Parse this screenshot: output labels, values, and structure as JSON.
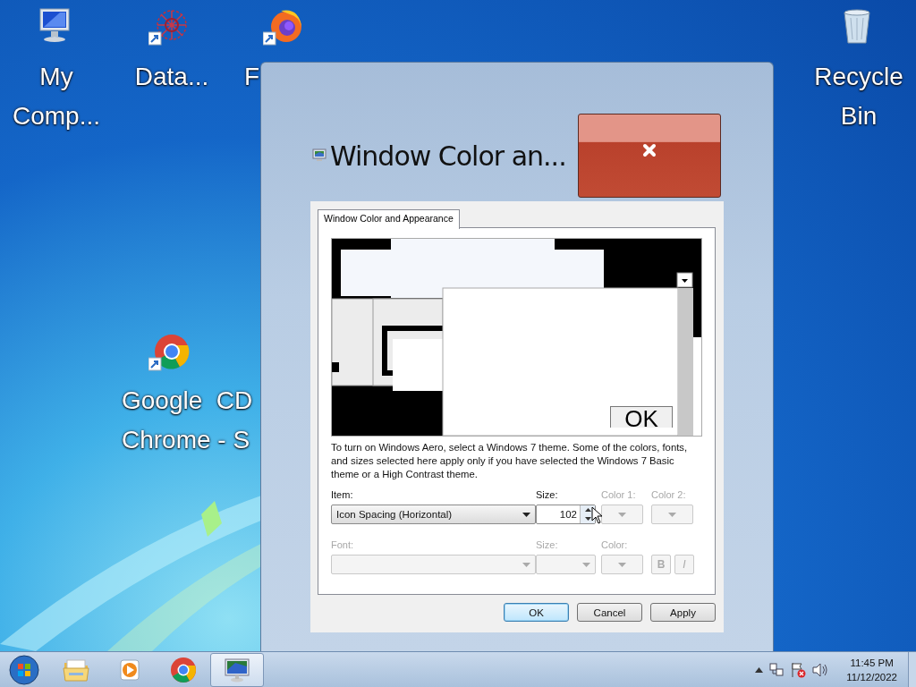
{
  "desktop_icons": [
    {
      "kind": "computer",
      "shortcut": false,
      "lines": [
        "My",
        "Comp..."
      ]
    },
    {
      "kind": "web",
      "shortcut": true,
      "lines": [
        "Data..."
      ]
    },
    {
      "kind": "firefox",
      "shortcut": true,
      "lines": [
        "F"
      ]
    },
    {
      "kind": "recycle",
      "shortcut": false,
      "lines": [
        "Recycle",
        "Bin"
      ]
    },
    {
      "kind": "chrome",
      "shortcut": true,
      "lines": [
        "Google  CD",
        "Chrome - S"
      ]
    }
  ],
  "window": {
    "title": "Window Color an...",
    "tabs": [
      {
        "label": "Window Color and Appearance",
        "selected": true
      }
    ],
    "preview": {
      "ok_label": "OK"
    },
    "description": "To turn on Windows Aero, select a Windows 7 theme.  Some of the colors, fonts, and sizes selected here apply only if you have selected the Windows 7 Basic theme or a High Contrast theme.",
    "row_1": [
      {
        "kind": "combo",
        "label": "Item:",
        "value": "Icon Spacing (Horizontal)",
        "disabled": false
      },
      {
        "kind": "spin",
        "label": "Size:",
        "value": "102",
        "disabled": false
      },
      {
        "kind": "color",
        "label": "Color 1:",
        "disabled": true
      },
      {
        "kind": "color",
        "label": "Color 2:",
        "disabled": true
      }
    ],
    "row_2": [
      {
        "kind": "combo",
        "label": "Font:",
        "disabled": true
      },
      {
        "kind": "combo-small",
        "label": "Size:",
        "disabled": true
      },
      {
        "kind": "color",
        "label": "Color:",
        "disabled": true
      },
      {
        "kind": "style",
        "buttons": [
          "B",
          "I"
        ],
        "disabled": true
      }
    ],
    "buttons": [
      {
        "label": "OK",
        "default": true
      },
      {
        "label": "Cancel",
        "default": false
      },
      {
        "label": "Apply",
        "default": false
      }
    ]
  },
  "taskbar": {
    "apps": [
      {
        "kind": "explorer",
        "active": false
      },
      {
        "kind": "media",
        "active": false
      },
      {
        "kind": "chrome",
        "active": false
      },
      {
        "kind": "control-panel",
        "active": true
      }
    ],
    "time": "11:45 PM",
    "date": "11/12/2022"
  }
}
